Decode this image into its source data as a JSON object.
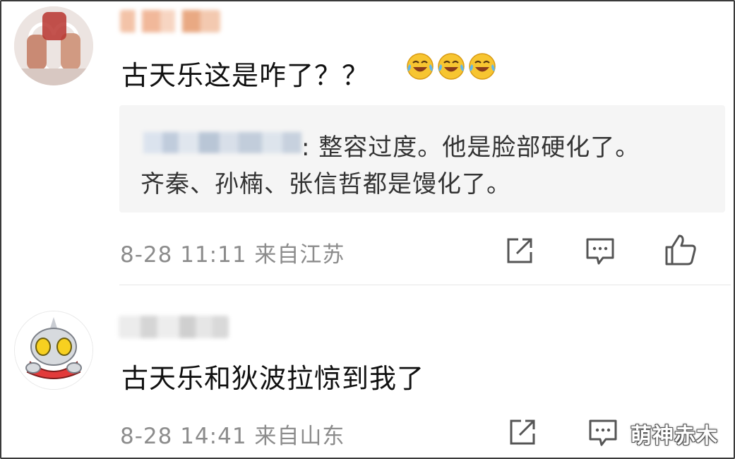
{
  "comments": [
    {
      "text": "古天乐这是咋了？？",
      "emojis": [
        "laugh-cry-icon",
        "laugh-cry-icon",
        "laugh-cry-icon"
      ],
      "reply": {
        "line1": ": 整容过度。他是脸部硬化了。",
        "line2": "齐秦、孙楠、张信哲都是馒化了。"
      },
      "meta": "8-28 11:11  来自江苏",
      "actions": [
        "share-icon",
        "comment-icon",
        "like-icon"
      ]
    },
    {
      "text": "古天乐和狄波拉惊到我了",
      "meta": "8-28 14:41  来自山东",
      "actions": [
        "share-icon",
        "comment-icon"
      ]
    }
  ],
  "watermark": "萌神赤木",
  "colors": {
    "text": "#111111",
    "meta": "#8c8c8c",
    "reply_bg": "#f5f5f5",
    "icon": "#555555"
  }
}
